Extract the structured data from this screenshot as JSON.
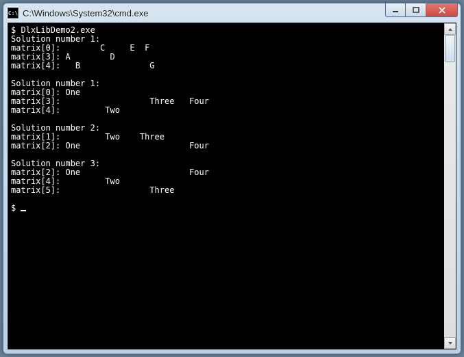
{
  "window": {
    "title": "C:\\Windows\\System32\\cmd.exe",
    "icon_label": "C:\\"
  },
  "console": {
    "lines": [
      "$ DlxLibDemo2.exe",
      "Solution number 1:",
      "matrix[0]:        C     E  F",
      "matrix[3]: A        D",
      "matrix[4]:   B              G",
      "",
      "Solution number 1:",
      "matrix[0]: One",
      "matrix[3]:                  Three   Four",
      "matrix[4]:         Two",
      "",
      "Solution number 2:",
      "matrix[1]:         Two    Three",
      "matrix[2]: One                      Four",
      "",
      "Solution number 3:",
      "matrix[2]: One                      Four",
      "matrix[4]:         Two",
      "matrix[5]:                  Three",
      ""
    ],
    "prompt": "$ "
  }
}
